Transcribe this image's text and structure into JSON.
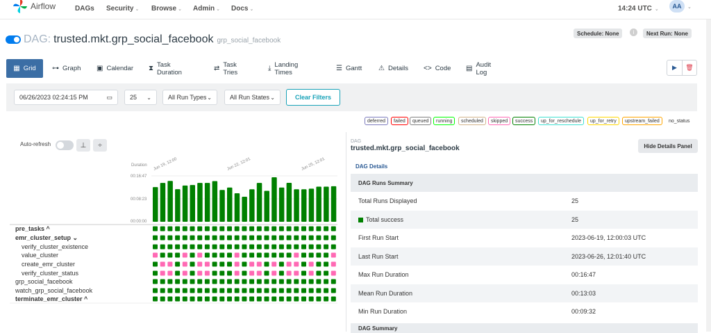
{
  "nav": {
    "brand": "Airflow",
    "menu": [
      {
        "label": "DAGs",
        "caret": false
      },
      {
        "label": "Security",
        "caret": true
      },
      {
        "label": "Browse",
        "caret": true
      },
      {
        "label": "Admin",
        "caret": true
      },
      {
        "label": "Docs",
        "caret": true
      }
    ],
    "time": "14:24 UTC",
    "avatar": "AA"
  },
  "dag": {
    "prefix": "DAG:",
    "name": "trusted.mkt.grp_social_facebook",
    "tag": "grp_social_facebook",
    "schedule": "Schedule: None",
    "next_run": "Next Run: None",
    "paused": false
  },
  "tabs": [
    {
      "label": "Grid",
      "icon": "grid-icon",
      "active": true
    },
    {
      "label": "Graph",
      "icon": "graph-icon",
      "active": false
    },
    {
      "label": "Calendar",
      "icon": "calendar-icon",
      "active": false
    },
    {
      "label": "Task Duration",
      "icon": "hourglass-icon",
      "active": false
    },
    {
      "label": "Task Tries",
      "icon": "retry-icon",
      "active": false
    },
    {
      "label": "Landing Times",
      "icon": "landing-icon",
      "active": false
    },
    {
      "label": "Gantt",
      "icon": "gantt-icon",
      "active": false
    },
    {
      "label": "Details",
      "icon": "warning-icon",
      "active": false
    },
    {
      "label": "Code",
      "icon": "code-icon",
      "active": false
    },
    {
      "label": "Audit Log",
      "icon": "document-icon",
      "active": false
    }
  ],
  "filters": {
    "datetime": "06/26/2023 02:24:15 PM",
    "num_runs": "25",
    "run_types": "All Run Types",
    "run_states": "All Run States",
    "clear": "Clear Filters"
  },
  "legend": [
    {
      "label": "deferred",
      "color": "#7d7cbd"
    },
    {
      "label": "failed",
      "color": "#ff0000"
    },
    {
      "label": "queued",
      "color": "#808080"
    },
    {
      "label": "running",
      "color": "#00ff00"
    },
    {
      "label": "scheduled",
      "color": "#d2b48c"
    },
    {
      "label": "skipped",
      "color": "#ff69b4"
    },
    {
      "label": "success",
      "color": "#008000"
    },
    {
      "label": "up_for_reschedule",
      "color": "#40e0d0"
    },
    {
      "label": "up_for_retry",
      "color": "#ffd700"
    },
    {
      "label": "upstream_failed",
      "color": "#ffa500"
    },
    {
      "label": "no_status",
      "color": ""
    }
  ],
  "grid": {
    "autorefresh": "Auto-refresh",
    "duration_label": "Duration",
    "y_ticks": [
      "00:16:47",
      "00:08:23",
      "00:00:00"
    ],
    "x_dates": [
      "Jun 19, 12:00",
      "Jun 22, 12:01",
      "Jun 25, 12:01"
    ],
    "run_durations_sec": [
      785,
      880,
      925,
      738,
      820,
      832,
      880,
      880,
      920,
      720,
      774,
      645,
      567,
      735,
      880,
      700,
      1007,
      774,
      882,
      736,
      735,
      749,
      795,
      795,
      805
    ],
    "tasks": [
      {
        "label": "pre_tasks ^",
        "type": "group"
      },
      {
        "label": "emr_cluster_setup ⌄",
        "type": "group"
      },
      {
        "label": "verify_cluster_existence",
        "type": "child"
      },
      {
        "label": "value_cluster",
        "type": "child"
      },
      {
        "label": "create_emr_cluster",
        "type": "child"
      },
      {
        "label": "verify_cluster_status",
        "type": "child"
      },
      {
        "label": "grp_social_facebook",
        "type": "task"
      },
      {
        "label": "watch_grp_social_facebook",
        "type": "task"
      },
      {
        "label": "terminate_emr_cluster ^",
        "type": "group"
      }
    ],
    "status_rows": [
      "sssssssssssssssssssssssss",
      "sssssssssssssssssssssssss",
      "sssssssssssssssssssssssss",
      "pssspspsssspssssssspssssps",
      "sppspsppssspsppspsppspssps",
      "sppspsppssspsppspsppspssps",
      "sssssssssssssssssssssssss",
      "sssssssssssssssssssssssss",
      "sssssssssssssssssssssssss"
    ]
  },
  "details": {
    "small": "DAG",
    "title": "trusted.mkt.grp_social_facebook",
    "hide_btn": "Hide Details Panel",
    "link": "DAG Details",
    "summary_header": "DAG Runs Summary",
    "rows": [
      {
        "k": "Total Runs Displayed",
        "v": "25",
        "alt": false,
        "square": false
      },
      {
        "k": "Total success",
        "v": "25",
        "alt": true,
        "square": true
      },
      {
        "k": "First Run Start",
        "v": "2023-06-19, 12:00:03 UTC",
        "alt": false,
        "square": false
      },
      {
        "k": "Last Run Start",
        "v": "2023-06-26, 12:01:40 UTC",
        "alt": true,
        "square": false
      },
      {
        "k": "Max Run Duration",
        "v": "00:16:47",
        "alt": false,
        "square": false
      },
      {
        "k": "Mean Run Duration",
        "v": "00:13:03",
        "alt": true,
        "square": false
      },
      {
        "k": "Min Run Duration",
        "v": "00:09:32",
        "alt": false,
        "square": false
      }
    ],
    "summary2": "DAG Summary"
  },
  "colors": {
    "success": "#008000",
    "skipped": "#ff69b4",
    "accent": "#017cee"
  }
}
